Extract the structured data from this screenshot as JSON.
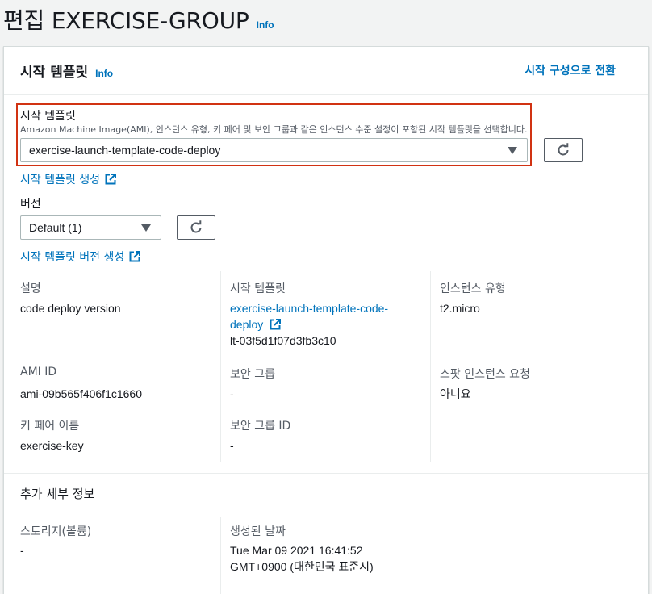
{
  "page": {
    "title": "편집 EXERCISE-GROUP",
    "info": "Info"
  },
  "panel": {
    "title": "시작 템플릿",
    "info": "Info",
    "switch_link": "시작 구성으로 전환"
  },
  "launch_template": {
    "label": "시작 템플릿",
    "description": "Amazon Machine Image(AMI), 인스턴스 유형, 키 페어 및 보안 그룹과 같은 인스턴스 수준 설정이 포함된 시작 템플릿을 선택합니다.",
    "selected": "exercise-launch-template-code-deploy",
    "create_link": "시작 템플릿 생성"
  },
  "version": {
    "label": "버전",
    "selected": "Default (1)",
    "create_link": "시작 템플릿 버전 생성"
  },
  "details": {
    "description": {
      "label": "설명",
      "value": "code deploy version"
    },
    "launch_template": {
      "label": "시작 템플릿",
      "link_line1": "exercise-launch-template-code-",
      "link_line2": "deploy",
      "id": "lt-03f5d1f07d3fb3c10"
    },
    "instance_type": {
      "label": "인스턴스 유형",
      "value": "t2.micro"
    },
    "ami_id": {
      "label": "AMI ID",
      "value": "ami-09b565f406f1c1660"
    },
    "security_groups": {
      "label": "보안 그룹",
      "value": "-"
    },
    "spot_request": {
      "label": "스팟 인스턴스 요청",
      "value": "아니요"
    },
    "key_pair": {
      "label": "키 페어 이름",
      "value": "exercise-key"
    },
    "security_group_ids": {
      "label": "보안 그룹 ID",
      "value": "-"
    }
  },
  "additional": {
    "title": "추가 세부 정보",
    "storage": {
      "label": "스토리지(볼륨)",
      "value": "-"
    },
    "created": {
      "label": "생성된 날짜",
      "value_line1": "Tue Mar 09 2021 16:41:52",
      "value_line2": "GMT+0900 (대한민국 표준시)"
    }
  },
  "icons": {
    "refresh": "refresh-icon",
    "external": "external-link-icon",
    "caret": "caret-down-icon"
  },
  "colors": {
    "link": "#0073bb",
    "highlight_border": "#d13212",
    "text": "#16191f",
    "label": "#545b64"
  }
}
